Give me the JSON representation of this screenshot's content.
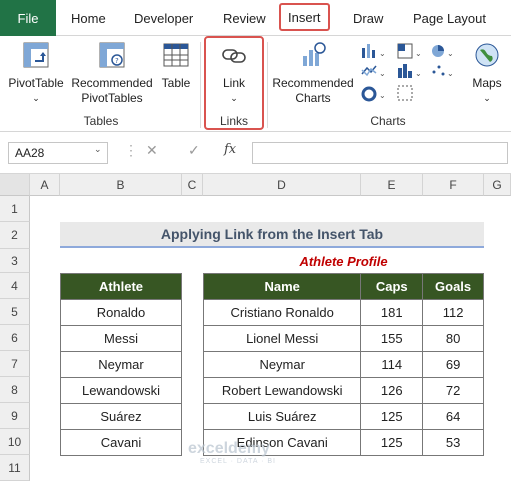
{
  "tabs": [
    "File",
    "Home",
    "Developer",
    "Review",
    "Insert",
    "Draw",
    "Page Layout"
  ],
  "ribbon": {
    "pivottable": "PivotTable",
    "recommended_pivot_1": "Recommended",
    "recommended_pivot_2": "PivotTables",
    "table": "Table",
    "link": "Link",
    "recommended_charts_1": "Recommended",
    "recommended_charts_2": "Charts",
    "maps": "Maps",
    "groups": {
      "tables": "Tables",
      "links": "Links",
      "charts": "Charts"
    }
  },
  "formula_bar": {
    "name_box": "AA28",
    "fx": "fx",
    "value": ""
  },
  "columns": [
    "A",
    "B",
    "C",
    "D",
    "E",
    "F",
    "G"
  ],
  "rows": [
    "1",
    "2",
    "3",
    "4",
    "5",
    "6",
    "7",
    "8",
    "9",
    "10",
    "11"
  ],
  "sheet": {
    "title": "Applying Link from the Insert Tab",
    "subtitle": "Athlete Profile",
    "athlete_header": "Athlete",
    "athletes": [
      "Ronaldo",
      "Messi",
      "Neymar",
      "Lewandowski",
      "Suárez",
      "Cavani"
    ],
    "profile_headers": [
      "Name",
      "Caps",
      "Goals"
    ],
    "profiles": [
      [
        "Cristiano Ronaldo",
        "181",
        "112"
      ],
      [
        "Lionel Messi",
        "155",
        "80"
      ],
      [
        "Neymar",
        "114",
        "69"
      ],
      [
        "Robert Lewandowski",
        "126",
        "72"
      ],
      [
        "Luis Suárez",
        "125",
        "64"
      ],
      [
        "Edinson Cavani",
        "125",
        "53"
      ]
    ]
  },
  "watermark": {
    "name": "exceldemy",
    "tagline": "EXCEL · DATA · BI"
  },
  "colors": {
    "file_tab": "#217346",
    "header_fill": "#375623",
    "highlight": "#d9534f",
    "subtitle": "#c00000"
  }
}
